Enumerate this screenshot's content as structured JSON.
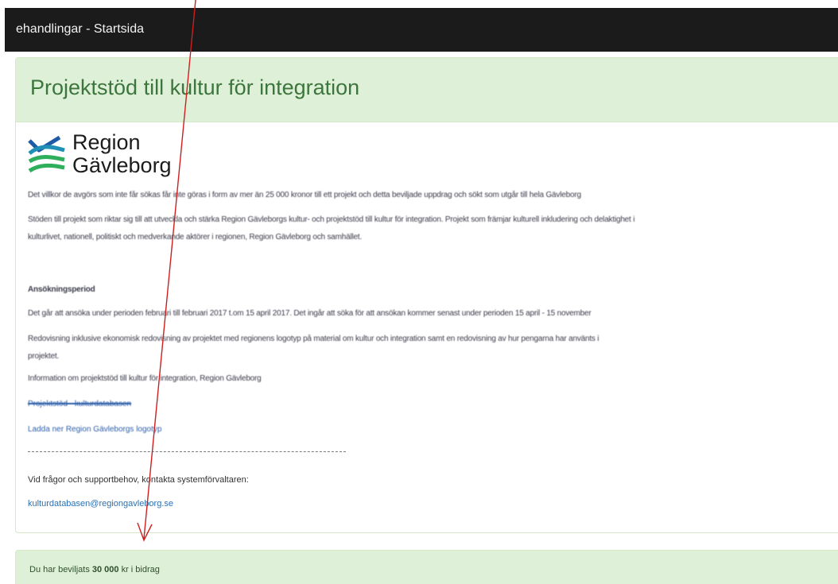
{
  "navbar": {
    "brand": "ehandlingar - Startsida"
  },
  "panel": {
    "title": "Projektstöd till kultur för integration",
    "logo": {
      "line1": "Region",
      "line2": "Gävleborg",
      "colors": {
        "blue": "#1f5aa6",
        "green": "#2fae5b"
      }
    },
    "blurred": {
      "p1": "Det villkor de avgörs som inte får sökas får inte göras i form av mer än 25 000 kronor till ett projekt och detta beviljade uppdrag och sökt som utgår till hela Gävleborg",
      "p2a": "Stöden till projekt som riktar sig till att utveckla och stärka Region Gävleborgs kultur- och projektstöd till kultur för integration. Projekt som främjar kulturell inkludering och delaktighet i",
      "p2b": "kulturlivet, nationell, politiskt och medverkande aktörer i regionen, Region Gävleborg och samhället.",
      "heading": "Ansökningsperiod",
      "p3": "Det går att ansöka under perioden februari till februari 2017 t.om 15 april 2017. Det ingår att söka för att ansökan kommer senast under perioden 15 april - 15 november",
      "p4a": "Redovisning inklusive ekonomisk redovisning av projektet med regionens logotyp på material om kultur och integration samt en redovisning av hur pengarna har använts i",
      "p4b": "projektet.",
      "p5": "Information om projektstöd till kultur för integration, Region Gävleborg",
      "link1": "Projektstöd - kulturdatabasen",
      "link2": "Ladda ner Region Gävleborgs logotyp"
    },
    "support": {
      "text": "Vid frågor och supportbehov, kontakta systemförvaltaren:",
      "email": "kulturdatabasen@regiongavleborg.se"
    }
  },
  "alert": {
    "prefix": "Du har beviljats ",
    "amount": "30 000",
    "suffix": " kr i bidrag"
  },
  "colors": {
    "navbar_bg": "#1b1b1b",
    "panel_heading_bg": "#dff0d8",
    "panel_title": "#3c763d",
    "link": "#2a6fb5",
    "annotation_arrow": "#cc1f1f"
  }
}
